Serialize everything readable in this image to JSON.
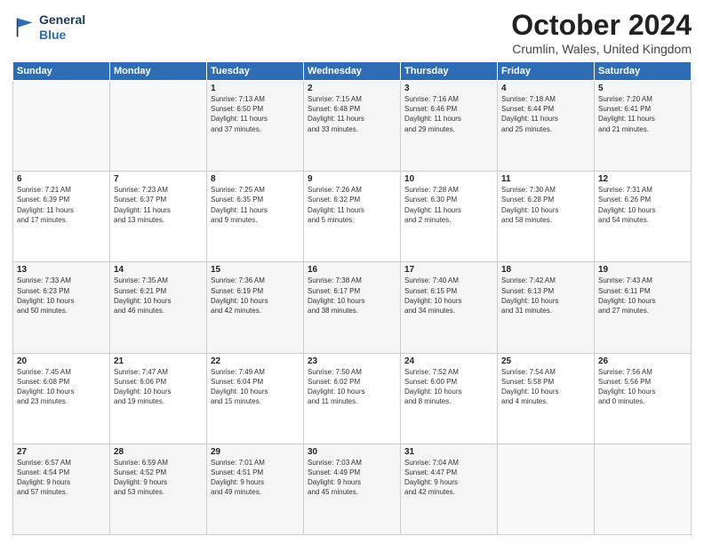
{
  "header": {
    "logo_line1": "General",
    "logo_line2": "Blue",
    "title": "October 2024",
    "location": "Crumlin, Wales, United Kingdom"
  },
  "weekdays": [
    "Sunday",
    "Monday",
    "Tuesday",
    "Wednesday",
    "Thursday",
    "Friday",
    "Saturday"
  ],
  "weeks": [
    [
      {
        "day": "",
        "info": ""
      },
      {
        "day": "",
        "info": ""
      },
      {
        "day": "1",
        "info": "Sunrise: 7:13 AM\nSunset: 6:50 PM\nDaylight: 11 hours\nand 37 minutes."
      },
      {
        "day": "2",
        "info": "Sunrise: 7:15 AM\nSunset: 6:48 PM\nDaylight: 11 hours\nand 33 minutes."
      },
      {
        "day": "3",
        "info": "Sunrise: 7:16 AM\nSunset: 6:46 PM\nDaylight: 11 hours\nand 29 minutes."
      },
      {
        "day": "4",
        "info": "Sunrise: 7:18 AM\nSunset: 6:44 PM\nDaylight: 11 hours\nand 25 minutes."
      },
      {
        "day": "5",
        "info": "Sunrise: 7:20 AM\nSunset: 6:41 PM\nDaylight: 11 hours\nand 21 minutes."
      }
    ],
    [
      {
        "day": "6",
        "info": "Sunrise: 7:21 AM\nSunset: 6:39 PM\nDaylight: 11 hours\nand 17 minutes."
      },
      {
        "day": "7",
        "info": "Sunrise: 7:23 AM\nSunset: 6:37 PM\nDaylight: 11 hours\nand 13 minutes."
      },
      {
        "day": "8",
        "info": "Sunrise: 7:25 AM\nSunset: 6:35 PM\nDaylight: 11 hours\nand 9 minutes."
      },
      {
        "day": "9",
        "info": "Sunrise: 7:26 AM\nSunset: 6:32 PM\nDaylight: 11 hours\nand 5 minutes."
      },
      {
        "day": "10",
        "info": "Sunrise: 7:28 AM\nSunset: 6:30 PM\nDaylight: 11 hours\nand 2 minutes."
      },
      {
        "day": "11",
        "info": "Sunrise: 7:30 AM\nSunset: 6:28 PM\nDaylight: 10 hours\nand 58 minutes."
      },
      {
        "day": "12",
        "info": "Sunrise: 7:31 AM\nSunset: 6:26 PM\nDaylight: 10 hours\nand 54 minutes."
      }
    ],
    [
      {
        "day": "13",
        "info": "Sunrise: 7:33 AM\nSunset: 6:23 PM\nDaylight: 10 hours\nand 50 minutes."
      },
      {
        "day": "14",
        "info": "Sunrise: 7:35 AM\nSunset: 6:21 PM\nDaylight: 10 hours\nand 46 minutes."
      },
      {
        "day": "15",
        "info": "Sunrise: 7:36 AM\nSunset: 6:19 PM\nDaylight: 10 hours\nand 42 minutes."
      },
      {
        "day": "16",
        "info": "Sunrise: 7:38 AM\nSunset: 6:17 PM\nDaylight: 10 hours\nand 38 minutes."
      },
      {
        "day": "17",
        "info": "Sunrise: 7:40 AM\nSunset: 6:15 PM\nDaylight: 10 hours\nand 34 minutes."
      },
      {
        "day": "18",
        "info": "Sunrise: 7:42 AM\nSunset: 6:13 PM\nDaylight: 10 hours\nand 31 minutes."
      },
      {
        "day": "19",
        "info": "Sunrise: 7:43 AM\nSunset: 6:11 PM\nDaylight: 10 hours\nand 27 minutes."
      }
    ],
    [
      {
        "day": "20",
        "info": "Sunrise: 7:45 AM\nSunset: 6:08 PM\nDaylight: 10 hours\nand 23 minutes."
      },
      {
        "day": "21",
        "info": "Sunrise: 7:47 AM\nSunset: 6:06 PM\nDaylight: 10 hours\nand 19 minutes."
      },
      {
        "day": "22",
        "info": "Sunrise: 7:49 AM\nSunset: 6:04 PM\nDaylight: 10 hours\nand 15 minutes."
      },
      {
        "day": "23",
        "info": "Sunrise: 7:50 AM\nSunset: 6:02 PM\nDaylight: 10 hours\nand 11 minutes."
      },
      {
        "day": "24",
        "info": "Sunrise: 7:52 AM\nSunset: 6:00 PM\nDaylight: 10 hours\nand 8 minutes."
      },
      {
        "day": "25",
        "info": "Sunrise: 7:54 AM\nSunset: 5:58 PM\nDaylight: 10 hours\nand 4 minutes."
      },
      {
        "day": "26",
        "info": "Sunrise: 7:56 AM\nSunset: 5:56 PM\nDaylight: 10 hours\nand 0 minutes."
      }
    ],
    [
      {
        "day": "27",
        "info": "Sunrise: 6:57 AM\nSunset: 4:54 PM\nDaylight: 9 hours\nand 57 minutes."
      },
      {
        "day": "28",
        "info": "Sunrise: 6:59 AM\nSunset: 4:52 PM\nDaylight: 9 hours\nand 53 minutes."
      },
      {
        "day": "29",
        "info": "Sunrise: 7:01 AM\nSunset: 4:51 PM\nDaylight: 9 hours\nand 49 minutes."
      },
      {
        "day": "30",
        "info": "Sunrise: 7:03 AM\nSunset: 4:49 PM\nDaylight: 9 hours\nand 45 minutes."
      },
      {
        "day": "31",
        "info": "Sunrise: 7:04 AM\nSunset: 4:47 PM\nDaylight: 9 hours\nand 42 minutes."
      },
      {
        "day": "",
        "info": ""
      },
      {
        "day": "",
        "info": ""
      }
    ]
  ]
}
